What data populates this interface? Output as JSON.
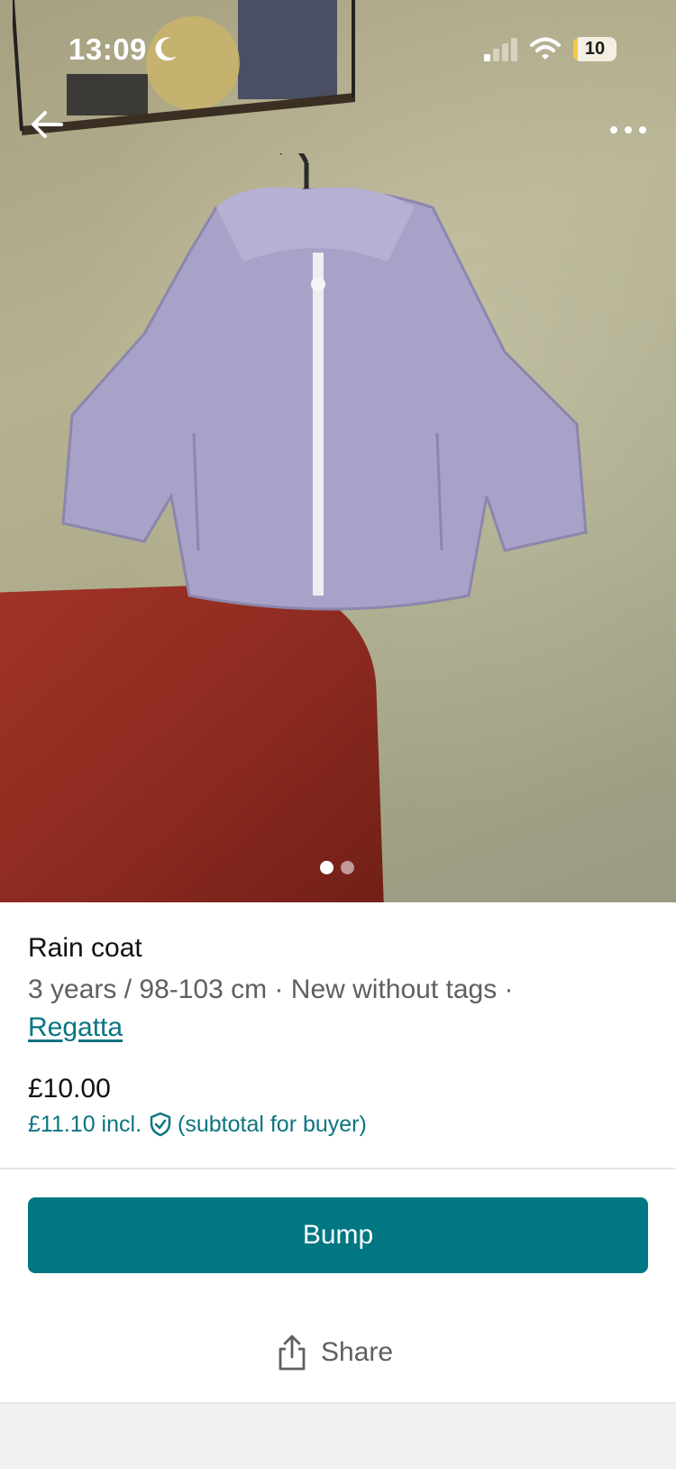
{
  "status_bar": {
    "time": "13:09",
    "battery": "10",
    "battery_level": 0.1
  },
  "photo": {
    "current_index": 1,
    "total": 2
  },
  "item": {
    "title": "Rain coat",
    "meta": "3 years / 98-103 cm · New without tags ·",
    "brand": "Regatta",
    "price": "£10.00",
    "price_incl": "£11.10 incl.",
    "price_note": "(subtotal for buyer)"
  },
  "actions": {
    "bump_label": "Bump",
    "share_label": "Share"
  },
  "icons": {
    "back": "arrow-left-icon",
    "more": "more-horizontal-icon",
    "shield": "shield-check-icon",
    "share": "share-icon",
    "moon": "moon-icon",
    "signal": "cellular-signal-icon",
    "wifi": "wifi-icon"
  },
  "colors": {
    "accent": "#007782",
    "link": "#0a7580",
    "muted_text": "#5f5f5f"
  }
}
